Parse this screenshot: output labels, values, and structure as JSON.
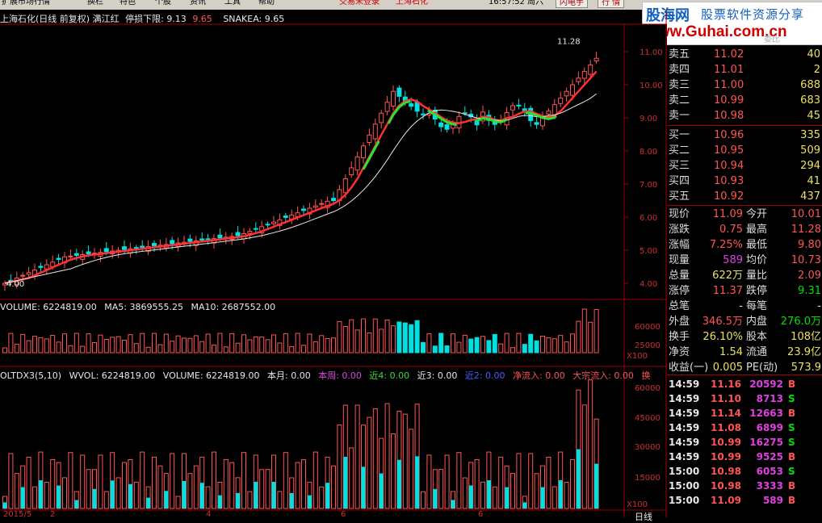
{
  "menubar": {
    "items": [
      "扩展市场行情",
      "换栏",
      "特色",
      "个股",
      "资讯",
      "工具",
      "帮助"
    ],
    "warning": "交易未登录",
    "stock": "上海石化",
    "time": "16:57:52 周六",
    "btn_trade": "闪电手",
    "btn_other": "行 情"
  },
  "watermark": {
    "brand_cn": "股海网",
    "tagline": "股票软件资源分享",
    "url": "www.Guhai.com.cn"
  },
  "price_panel": {
    "title": "上海石化(日线 前复权)",
    "indicator": "满江红",
    "stop_loss_label": "停损下限:",
    "stop_loss_a": "9.13",
    "stop_loss_b": "9.65",
    "snake_label": "SNAKEA:",
    "snake_value": "9.65",
    "high_mark": "11.28",
    "low_mark": "4.00",
    "y_ticks": [
      "11.00",
      "10.00",
      "9.00",
      "8.00",
      "7.00",
      "6.00",
      "5.00",
      "4.00"
    ]
  },
  "volume_panel": {
    "label": "VOLUME: 6224819.00",
    "ma5": "MA5: 3869555.25",
    "ma10": "MA10: 2687552.00",
    "y_ticks": [
      "60000",
      "25000"
    ],
    "unit": "X100"
  },
  "dx_panel": {
    "name": "OLTDX3(5,10)",
    "wvol": "WVOL: 6224819.00",
    "volume": "VOLUME: 6224819.00",
    "benyue": "本月: 0.00",
    "benzhou": "本周: 0.00",
    "jin4": "近4: 0.00",
    "jin3": "近3: 0.00",
    "jin2": "近2: 0.00",
    "jingliu": "净流入: 0.00",
    "dazong": "大宗流入: 0.00",
    "tail": "换",
    "y_ticks": [
      "60000",
      "45000",
      "30000",
      "15000"
    ],
    "unit": "X100"
  },
  "x_axis": {
    "labels": [
      "2015/5",
      "2",
      "4",
      "6",
      "6"
    ],
    "period": "日线"
  },
  "order_book": {
    "header": "委比",
    "asks": [
      {
        "label": "卖五",
        "price": "11.02",
        "vol": "40"
      },
      {
        "label": "卖四",
        "price": "11.01",
        "vol": "2"
      },
      {
        "label": "卖三",
        "price": "11.00",
        "vol": "688"
      },
      {
        "label": "卖二",
        "price": "10.99",
        "vol": "683"
      },
      {
        "label": "卖一",
        "price": "10.98",
        "vol": "45"
      }
    ],
    "bids": [
      {
        "label": "买一",
        "price": "10.96",
        "vol": "335"
      },
      {
        "label": "买二",
        "price": "10.95",
        "vol": "509"
      },
      {
        "label": "买三",
        "price": "10.94",
        "vol": "294"
      },
      {
        "label": "买四",
        "price": "10.93",
        "vol": "41"
      },
      {
        "label": "买五",
        "price": "10.92",
        "vol": "437"
      }
    ]
  },
  "quote": [
    {
      "l1": "现价",
      "v1": "11.09",
      "c1": "#ff5555",
      "l2": "今开",
      "v2": "10.01",
      "c2": "#ff5555"
    },
    {
      "l1": "涨跌",
      "v1": "0.75",
      "c1": "#ff5555",
      "l2": "最高",
      "v2": "11.28",
      "c2": "#ff5555"
    },
    {
      "l1": "涨幅",
      "v1": "7.25%",
      "c1": "#ff5555",
      "l2": "最低",
      "v2": "9.80",
      "c2": "#ff5555"
    },
    {
      "l1": "现量",
      "v1": "589",
      "c1": "#e040e0",
      "l2": "均价",
      "v2": "10.73",
      "c2": "#ff5555"
    },
    {
      "l1": "总量",
      "v1": "622万",
      "c1": "#e8e060",
      "l2": "量比",
      "v2": "2.09",
      "c2": "#ff5555"
    },
    {
      "l1": "涨停",
      "v1": "11.37",
      "c1": "#ff5555",
      "l2": "跌停",
      "v2": "9.31",
      "c2": "#00e000"
    },
    {
      "l1": "总笔",
      "v1": "-",
      "c1": "#e8e8e8",
      "l2": "每笔",
      "v2": "-",
      "c2": "#e8e8e8"
    },
    {
      "l1": "外盘",
      "v1": "346.5万",
      "c1": "#ff5555",
      "l2": "内盘",
      "v2": "276.0万",
      "c2": "#00e000"
    },
    {
      "l1": "换手",
      "v1": "26.10%",
      "c1": "#e8e060",
      "l2": "股本",
      "v2": "108亿",
      "c2": "#e8e060"
    },
    {
      "l1": "净资",
      "v1": "1.54",
      "c1": "#e8e060",
      "l2": "流通",
      "v2": "23.9亿",
      "c2": "#e8e060"
    },
    {
      "l1": "收益(一)",
      "v1": "0.005",
      "c1": "#e8e060",
      "l2": "PE(动)",
      "v2": "573.9",
      "c2": "#e8e060"
    }
  ],
  "ticks": [
    {
      "time": "14:59",
      "price": "11.16",
      "vol": "20592",
      "side": "B"
    },
    {
      "time": "14:59",
      "price": "11.10",
      "vol": "8713",
      "side": "S"
    },
    {
      "time": "14:59",
      "price": "11.14",
      "vol": "12663",
      "side": "B"
    },
    {
      "time": "14:59",
      "price": "11.08",
      "vol": "6899",
      "side": "S"
    },
    {
      "time": "14:59",
      "price": "10.99",
      "vol": "16275",
      "side": "S"
    },
    {
      "time": "14:59",
      "price": "10.99",
      "vol": "9525",
      "side": "B"
    },
    {
      "time": "15:00",
      "price": "10.98",
      "vol": "6053",
      "side": "S"
    },
    {
      "time": "15:00",
      "price": "10.98",
      "vol": "3333",
      "side": "B"
    },
    {
      "time": "15:00",
      "price": "11.09",
      "vol": "589",
      "side": "B"
    }
  ],
  "colors": {
    "up": "#ff5555",
    "down": "#00e0e0",
    "ma_main": "#ff3030",
    "ma_slow": "#e8e8e8",
    "snake_green": "#30e030"
  }
}
